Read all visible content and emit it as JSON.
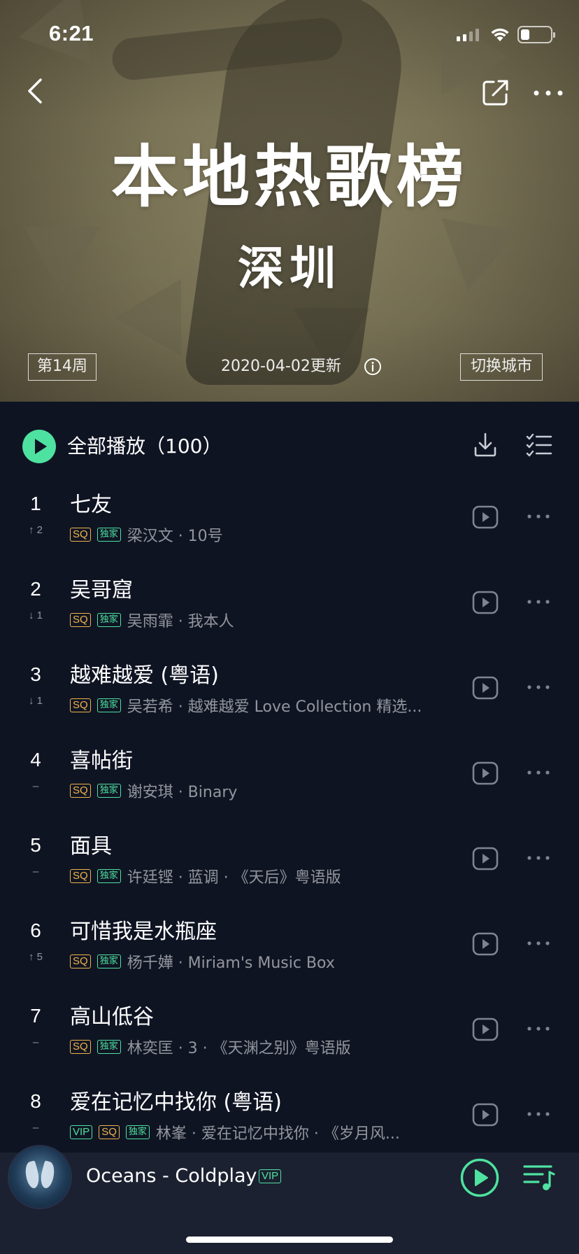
{
  "status_bar": {
    "time": "6:21"
  },
  "header": {
    "title": "本地热歌榜",
    "city": "深圳",
    "week_label": "第14周",
    "update_text": "2020-04-02更新",
    "switch_city_label": "切换城市"
  },
  "toolbar": {
    "play_all_label": "全部播放（100）"
  },
  "songs": [
    {
      "rank": "1",
      "change": "↑ 2",
      "title": "七友",
      "badges": [
        "SQ",
        "独家"
      ],
      "meta": "梁汉文 · 10号"
    },
    {
      "rank": "2",
      "change": "↓ 1",
      "title": "吴哥窟",
      "badges": [
        "SQ",
        "独家"
      ],
      "meta": "吴雨霏 · 我本人"
    },
    {
      "rank": "3",
      "change": "↓ 1",
      "title": "越难越爱 (粤语)",
      "badges": [
        "SQ",
        "独家"
      ],
      "meta": "吴若希 · 越难越爱 Love Collection 精选..."
    },
    {
      "rank": "4",
      "change": "–",
      "title": "喜帖街",
      "badges": [
        "SQ",
        "独家"
      ],
      "meta": "谢安琪 · Binary"
    },
    {
      "rank": "5",
      "change": "–",
      "title": "面具",
      "badges": [
        "SQ",
        "独家"
      ],
      "meta": "许廷铿 · 蓝调 · 《天后》粤语版"
    },
    {
      "rank": "6",
      "change": "↑ 5",
      "title": "可惜我是水瓶座",
      "badges": [
        "SQ",
        "独家"
      ],
      "meta": "杨千嬅 · Miriam's Music Box"
    },
    {
      "rank": "7",
      "change": "–",
      "title": "高山低谷",
      "badges": [
        "SQ",
        "独家"
      ],
      "meta": "林奕匡 · 3 · 《天渊之别》粤语版"
    },
    {
      "rank": "8",
      "change": "–",
      "title": "爱在记忆中找你 (粤语)",
      "badges": [
        "VIP",
        "SQ",
        "独家"
      ],
      "meta": "林峯 · 爱在记忆中找你 · 《岁月风..."
    }
  ],
  "mini_player": {
    "now_playing": "Oceans - Coldplay",
    "badge": "VIP"
  },
  "colors": {
    "accent": "#4ee2a0",
    "sq_badge": "#f0b44c",
    "list_bg": "#0f1423",
    "player_bg": "#1b2130"
  },
  "icons": {
    "back": "back-icon",
    "share": "share-icon",
    "more": "more-icon",
    "info": "info-icon",
    "play_all": "play-circle-icon",
    "download": "download-icon",
    "multi_select": "multiselect-icon",
    "mv": "mv-play-icon",
    "mini_play": "play-icon",
    "playlist": "playlist-icon"
  }
}
